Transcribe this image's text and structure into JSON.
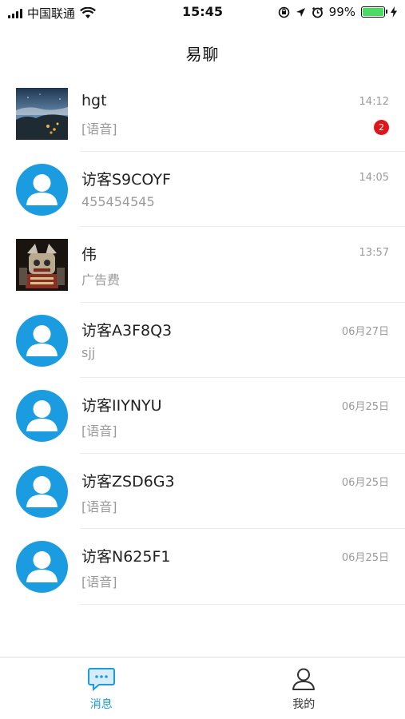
{
  "status_bar": {
    "carrier": "中国联通",
    "time": "15:45",
    "battery_percent": "99%",
    "battery_level": 0.99,
    "icons": [
      "signal-icon",
      "wifi-icon",
      "orientation-lock-icon",
      "location-icon",
      "alarm-icon",
      "battery-icon",
      "charging-icon"
    ]
  },
  "nav": {
    "title": "易聊"
  },
  "conversations": [
    {
      "name": "hgt",
      "last_message": "[语音]",
      "time": "14:12",
      "unread": "2",
      "avatar": "photo-landscape"
    },
    {
      "name": "访客S9COYF",
      "last_message": "455454545",
      "time": "14:05",
      "avatar": "default-user"
    },
    {
      "name": "伟",
      "last_message": "广告费",
      "time": "13:57",
      "avatar": "photo-cartoon"
    },
    {
      "name": "访客A3F8Q3",
      "last_message": "sjj",
      "time": "06月27日",
      "avatar": "default-user"
    },
    {
      "name": "访客IIYNYU",
      "last_message": "[语音]",
      "time": "06月25日",
      "avatar": "default-user"
    },
    {
      "name": "访客ZSD6G3",
      "last_message": "[语音]",
      "time": "06月25日",
      "avatar": "default-user"
    },
    {
      "name": "访客N625F1",
      "last_message": "[语音]",
      "time": "06月25日",
      "avatar": "default-user"
    }
  ],
  "tabbar": {
    "messages_label": "消息",
    "me_label": "我的",
    "active_color": "#1c9ce0",
    "inactive_color": "#333333"
  }
}
